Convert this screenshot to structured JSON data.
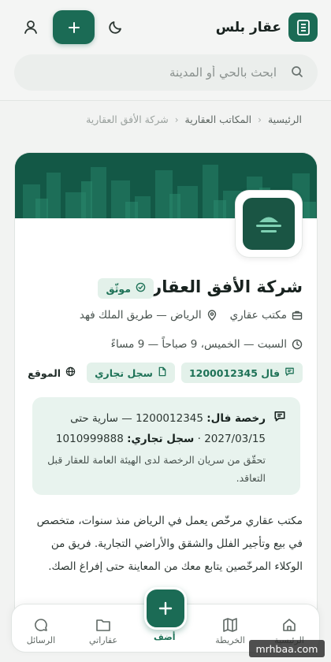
{
  "header": {
    "brand_name": "عقار بلس",
    "add_label": "+"
  },
  "search": {
    "placeholder": "ابحث بالحي أو المدينة"
  },
  "breadcrumb": {
    "home": "الرئيسية",
    "offices": "المكاتب العقارية",
    "current": "شركة الأفق العقارية"
  },
  "company": {
    "name": "شركة الأفق العقارية",
    "verified_badge": "موثّق",
    "type": "مكتب عقاري",
    "location": "الرياض — طريق الملك فهد",
    "hours": "السبت — الخميس، 9 صباحاً — 9 مساءً",
    "chip_fal": "فال 1200012345",
    "chip_cr": "سجل تجاري",
    "website": "الموقع"
  },
  "license": {
    "fal_label": "رخصة فال:",
    "fal_value": "1200012345 — سارية حتى",
    "fal_expiry": "2027/03/15 ·",
    "cr_label": "سجل تجاري:",
    "cr_value": "1010999888",
    "note": "تحقّق من سريان الرخصة لدى الهيئة العامة للعقار قبل التعاقد."
  },
  "description": "مكتب عقاري مرخّص يعمل في الرياض منذ سنوات، متخصص في بيع وتأجير الفلل والشقق والأراضي التجارية. فريق من الوكلاء المرخّصين يتابع معك من المعاينة حتى إفراغ الصك.",
  "nav": {
    "home": "الرئيسية",
    "map": "الخريطة",
    "add": "أضف",
    "my_properties": "عقاراتي",
    "messages": "الرسائل"
  },
  "watermark": "mrhbaa.com",
  "colors": {
    "primary": "#1b6b55",
    "badge_bg": "#e3f1ea",
    "badge_text": "#1e7257",
    "license_bg": "#e8f3ee"
  }
}
